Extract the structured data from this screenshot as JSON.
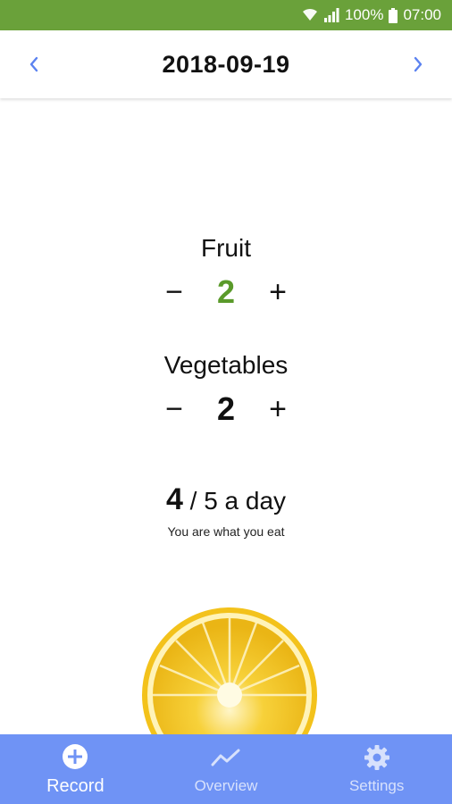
{
  "status_bar": {
    "battery": "100%",
    "time": "07:00"
  },
  "header": {
    "date": "2018-09-19",
    "prev_icon": "chevron-left-icon",
    "next_icon": "chevron-right-icon"
  },
  "counters": [
    {
      "label": "Fruit",
      "value": "2",
      "minus": "−",
      "plus": "+",
      "value_color": "#5a9a2a"
    },
    {
      "label": "Vegetables",
      "value": "2",
      "minus": "−",
      "plus": "+",
      "value_color": "#111111"
    }
  ],
  "summary": {
    "count": "4",
    "rest": " / 5 a day",
    "subtitle": "You are what you eat"
  },
  "bottom_nav": [
    {
      "label": "Record",
      "icon": "add-circle-icon",
      "active": true
    },
    {
      "label": "Overview",
      "icon": "trend-line-icon",
      "active": false
    },
    {
      "label": "Settings",
      "icon": "gear-icon",
      "active": false
    }
  ],
  "colors": {
    "status_bar": "#6aa13a",
    "accent_blue": "#6f93f5",
    "fruit_value": "#5a9a2a"
  }
}
